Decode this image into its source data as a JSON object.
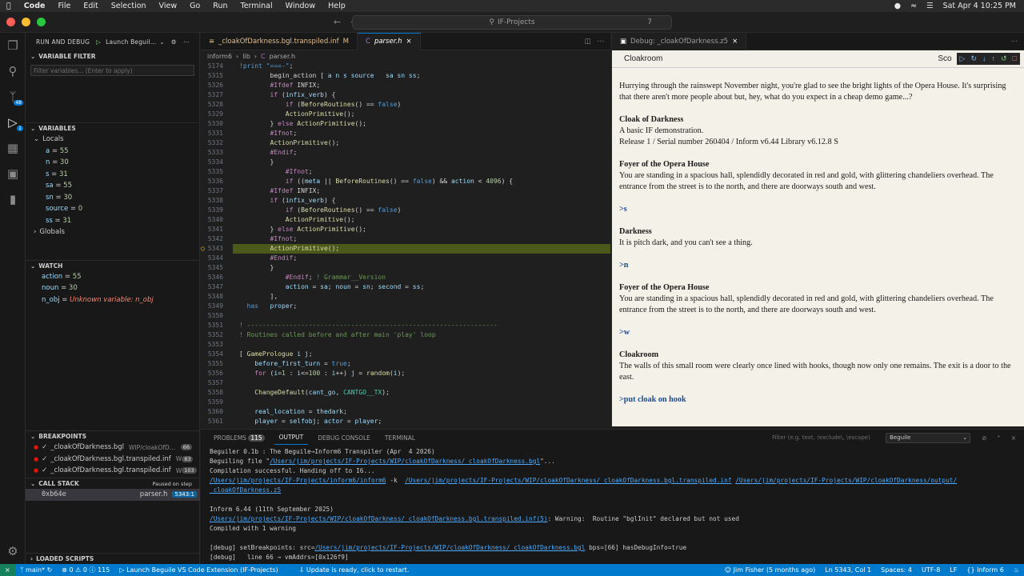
{
  "menubar": {
    "app": "Code",
    "items": [
      "File",
      "Edit",
      "Selection",
      "View",
      "Go",
      "Run",
      "Terminal",
      "Window",
      "Help"
    ],
    "clock": "Sat Apr 4 10:25 PM"
  },
  "titlebar": {
    "search": "IF-Projects",
    "count": "7"
  },
  "activity": {
    "badge1": "48",
    "badge2": "1"
  },
  "sidebar": {
    "header": "RUN AND DEBUG",
    "launch": "Launch Beguil…",
    "filter_title": "VARIABLE FILTER",
    "filter_placeholder": "Filter variables... (Enter to apply)",
    "variables_title": "VARIABLES",
    "locals": "Locals",
    "vars": [
      {
        "name": "a",
        "value": "55"
      },
      {
        "name": "n",
        "value": "30"
      },
      {
        "name": "s",
        "value": "31"
      },
      {
        "name": "sa",
        "value": "55"
      },
      {
        "name": "sn",
        "value": "30"
      },
      {
        "name": "source",
        "value": "0"
      },
      {
        "name": "ss",
        "value": "31"
      }
    ],
    "globals": "Globals",
    "watch_title": "WATCH",
    "watch": [
      {
        "name": "action",
        "value": "55"
      },
      {
        "name": "noun",
        "value": "30"
      },
      {
        "name": "n_obj",
        "value": "Unknown variable: n_obj"
      }
    ],
    "breakpoints_title": "BREAKPOINTS",
    "breakpoints": [
      {
        "file": "_cloakOfDarkness.bgl",
        "path": "WIP/cloakOfD…",
        "line": "66"
      },
      {
        "file": "_cloakOfDarkness.bgl.transpiled.inf",
        "path": "W",
        "line": "83"
      },
      {
        "file": "_cloakOfDarkness.bgl.transpiled.inf",
        "path": "W",
        "line": "103"
      }
    ],
    "callstack_title": "CALL STACK",
    "callstack_status": "Paused on step",
    "frame": {
      "addr": "0xb64e",
      "file": "parser.h",
      "line": "5343:1"
    },
    "loaded_scripts": "LOADED SCRIPTS"
  },
  "editor": {
    "tabs": [
      {
        "label": "_cloakOfDarkness.bgl.transpiled.inf",
        "mark": "M"
      },
      {
        "label": "parser.h",
        "mark": "×"
      }
    ],
    "breadcrumbs": [
      "inform6",
      "lib",
      "parser.h"
    ]
  },
  "debugtab": {
    "label": "Debug: _cloakOfDarkness.z5"
  },
  "game": {
    "header": "Cloakroom",
    "score": "Sco",
    "paragraphs": [
      {
        "title": "",
        "text": "Hurrying through the rainswept November night, you're glad to see the bright lights of the Opera House. It's surprising that there aren't more people about but, hey, what do you expect in a cheap demo game...?"
      },
      {
        "title": "Cloak of Darkness",
        "text": "A basic IF demonstration.\nRelease 1 / Serial number 260404 / Inform v6.44 Library v6.12.8 S"
      },
      {
        "title": "Foyer of the Opera House",
        "text": "You are standing in a spacious hall, splendidly decorated in red and gold, with glittering chandeliers overhead. The entrance from the street is to the north, and there are doorways south and west."
      },
      {
        "cmd": ">s"
      },
      {
        "title": "Darkness",
        "text": "It is pitch dark, and you can't see a thing."
      },
      {
        "cmd": ">n"
      },
      {
        "title": "Foyer of the Opera House",
        "text": "You are standing in a spacious hall, splendidly decorated in red and gold, with glittering chandeliers overhead. The entrance from the street is to the north, and there are doorways south and west."
      },
      {
        "cmd": ">w"
      },
      {
        "title": "Cloakroom",
        "text": "The walls of this small room were clearly once lined with hooks, though now only one remains. The exit is a door to the east."
      },
      {
        "cmd": ">put cloak on hook"
      }
    ]
  },
  "panel": {
    "tabs": [
      "PROBLEMS",
      "OUTPUT",
      "DEBUG CONSOLE",
      "TERMINAL"
    ],
    "problems_count": "115",
    "filter_placeholder": "Filter (e.g. text, !exclude\\, \\escape)",
    "channel": "Beguile"
  },
  "statusbar": {
    "branch": "main*",
    "errors": "0",
    "warnings": "0",
    "info": "115",
    "launch": "Launch Beguile VS Code Extension (IF-Projects)",
    "update": "Update is ready, click to restart.",
    "blame": "Jim Fisher (5 months ago)",
    "position": "Ln 5343, Col 1",
    "spaces": "Spaces: 4",
    "encoding": "UTF-8",
    "eol": "LF",
    "language": "Inform 6"
  }
}
